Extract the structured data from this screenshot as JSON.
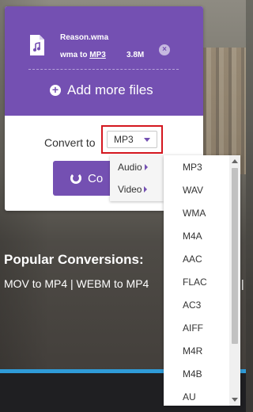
{
  "file": {
    "name": "Reason.wma",
    "conversion_prefix": "wma to",
    "target_format": "MP3",
    "size": "3.8M",
    "remove_glyph": "×"
  },
  "add_more_files": "Add more files",
  "convert_to_label": "Convert to",
  "format_select": {
    "value": "MP3"
  },
  "convert_button": {
    "label": "Co"
  },
  "category_menu": [
    "Audio",
    "Video"
  ],
  "format_list": [
    "MP3",
    "WAV",
    "WMA",
    "M4A",
    "AAC",
    "FLAC",
    "AC3",
    "AIFF",
    "M4R",
    "M4B",
    "AU"
  ],
  "popular": {
    "title": "Popular Conversions:",
    "links_text": "MOV to MP4 | WEBM to MP4",
    "tail": "|"
  },
  "colors": {
    "accent": "#7450b2",
    "highlight_border": "#d4171f",
    "strip": "#2f9bd8"
  }
}
